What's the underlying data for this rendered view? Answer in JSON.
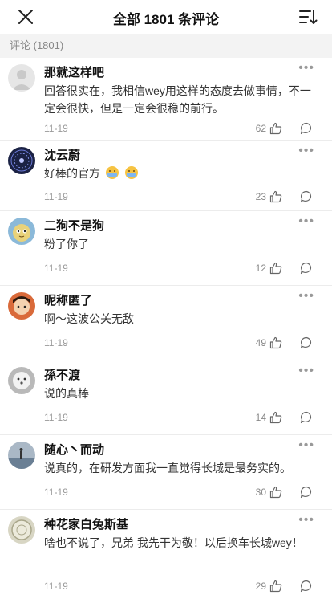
{
  "header": {
    "title": "全部 1801 条评论",
    "close_icon": "close-icon",
    "sort_icon": "sort-icon"
  },
  "section_label": "评论 (1801)",
  "comments": [
    {
      "name": "那就这样吧",
      "text": "回答很实在，我相信wey用这样的态度去做事情，不一定会很快，但是一定会很稳的前行。",
      "date": "11-19",
      "likes": "62"
    },
    {
      "name": "沈云蔚",
      "text": "好棒的官方",
      "date": "11-19",
      "likes": "23"
    },
    {
      "name": "二狗不是狗",
      "text": "粉了你了",
      "date": "11-19",
      "likes": "12"
    },
    {
      "name": "昵称匿了",
      "text": "啊～这波公关无敌",
      "date": "11-19",
      "likes": "49"
    },
    {
      "name": "孫不渡",
      "text": "说的真棒",
      "date": "11-19",
      "likes": "14"
    },
    {
      "name": "随心丶而动",
      "text": "说真的，在研发方面我一直觉得长城是最务实的。",
      "date": "11-19",
      "likes": "30"
    },
    {
      "name": "种花家白兔斯基",
      "text": "啥也不说了，兄弟 我先干为敬！以后换车长城wey！",
      "date": "11-19",
      "likes": "29"
    }
  ],
  "colors": {
    "accent_emoji": "#f6c342",
    "muted": "#999999",
    "divider": "#ececec"
  }
}
